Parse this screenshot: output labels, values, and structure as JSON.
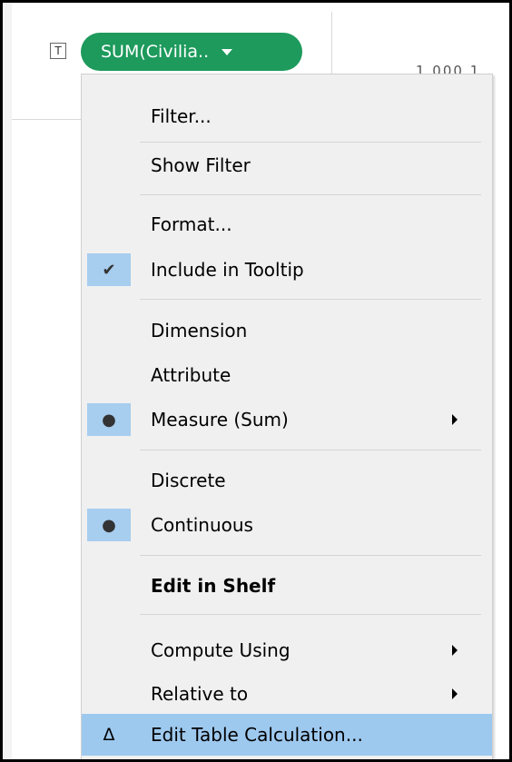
{
  "pill": {
    "label": "SUM(Civilia.."
  },
  "marks_type_icon": {
    "glyph": "T"
  },
  "background_partial_text": "1,000,1",
  "colors": {
    "pill": "#1d9a5c",
    "highlight": "#9ec9ef",
    "check_gutter": "#a7cdef",
    "menu_bg": "#f0f0f0"
  },
  "menu": {
    "items": [
      {
        "label": "Filter..."
      },
      {
        "label": "Show Filter"
      },
      {
        "label": "Format..."
      },
      {
        "label": "Include in Tooltip",
        "checked": true,
        "mark": "✔",
        "icon": "check-icon"
      },
      {
        "label": "Dimension"
      },
      {
        "label": "Attribute"
      },
      {
        "label": "Measure (Sum)",
        "checked": true,
        "mark": "●",
        "icon": "radio-dot-icon",
        "submenu": true
      },
      {
        "label": "Discrete"
      },
      {
        "label": "Continuous",
        "checked": true,
        "mark": "●",
        "icon": "radio-dot-icon"
      },
      {
        "label": "Edit in Shelf",
        "bold": true
      },
      {
        "label": "Compute Using",
        "submenu": true
      },
      {
        "label": "Relative to",
        "submenu": true
      },
      {
        "label": "Edit Table Calculation...",
        "mark": "Δ",
        "icon": "delta-icon",
        "highlighted": true
      }
    ]
  }
}
